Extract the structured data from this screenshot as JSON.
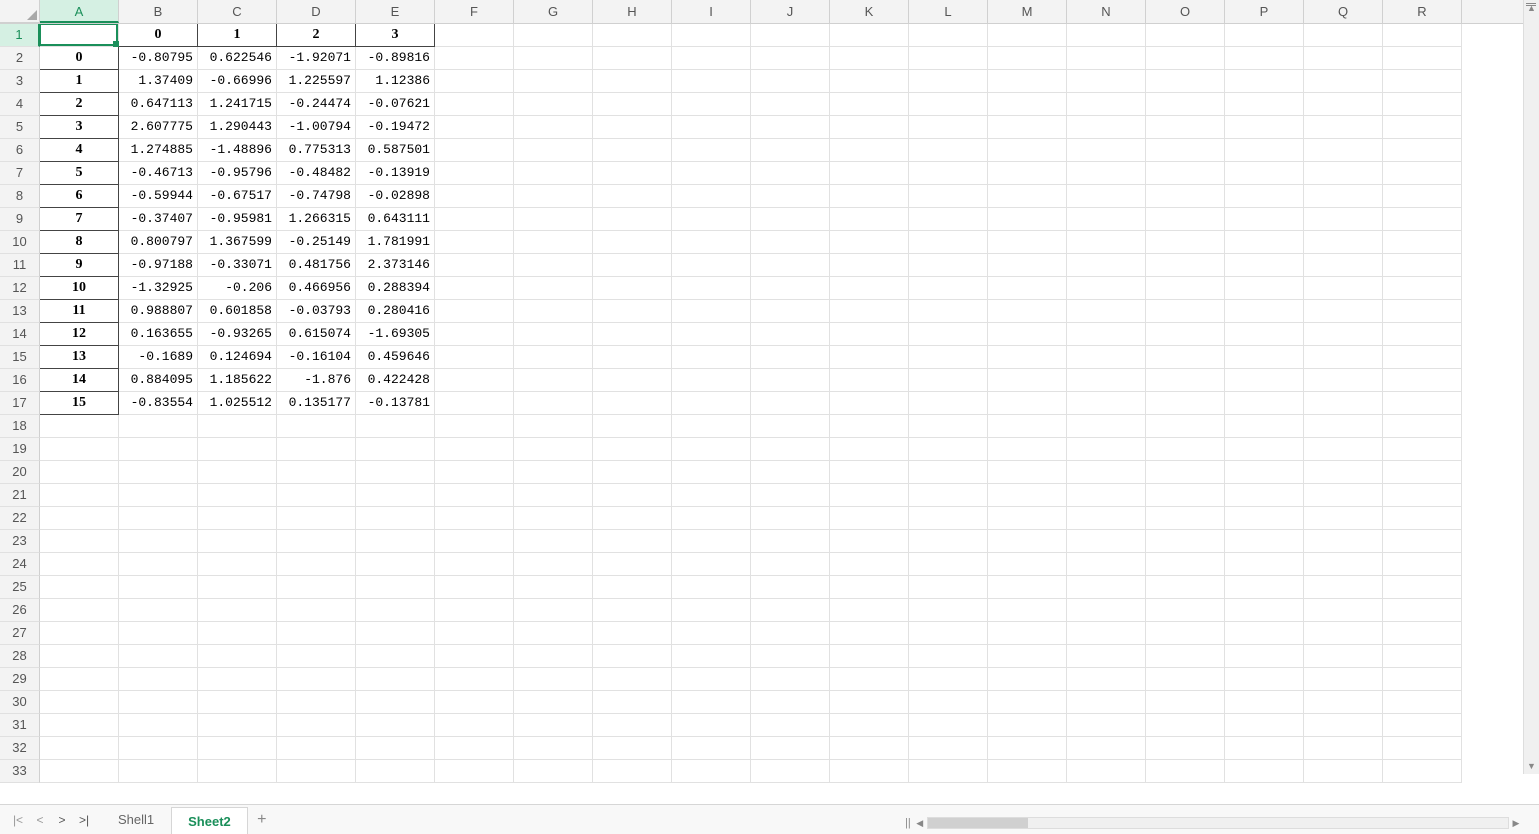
{
  "columns": [
    "A",
    "B",
    "C",
    "D",
    "E",
    "F",
    "G",
    "H",
    "I",
    "J",
    "K",
    "L",
    "M",
    "N",
    "O",
    "P",
    "Q",
    "R"
  ],
  "row_count": 33,
  "data_headers": [
    "",
    "0",
    "1",
    "2",
    "3"
  ],
  "data_rows": [
    {
      "idx": "0",
      "v": [
        "-0.80795",
        "0.622546",
        "-1.92071",
        "-0.89816"
      ]
    },
    {
      "idx": "1",
      "v": [
        "1.37409",
        "-0.66996",
        "1.225597",
        "1.12386"
      ]
    },
    {
      "idx": "2",
      "v": [
        "0.647113",
        "1.241715",
        "-0.24474",
        "-0.07621"
      ]
    },
    {
      "idx": "3",
      "v": [
        "2.607775",
        "1.290443",
        "-1.00794",
        "-0.19472"
      ]
    },
    {
      "idx": "4",
      "v": [
        "1.274885",
        "-1.48896",
        "0.775313",
        "0.587501"
      ]
    },
    {
      "idx": "5",
      "v": [
        "-0.46713",
        "-0.95796",
        "-0.48482",
        "-0.13919"
      ]
    },
    {
      "idx": "6",
      "v": [
        "-0.59944",
        "-0.67517",
        "-0.74798",
        "-0.02898"
      ]
    },
    {
      "idx": "7",
      "v": [
        "-0.37407",
        "-0.95981",
        "1.266315",
        "0.643111"
      ]
    },
    {
      "idx": "8",
      "v": [
        "0.800797",
        "1.367599",
        "-0.25149",
        "1.781991"
      ]
    },
    {
      "idx": "9",
      "v": [
        "-0.97188",
        "-0.33071",
        "0.481756",
        "2.373146"
      ]
    },
    {
      "idx": "10",
      "v": [
        "-1.32925",
        "-0.206",
        "0.466956",
        "0.288394"
      ]
    },
    {
      "idx": "11",
      "v": [
        "0.988807",
        "0.601858",
        "-0.03793",
        "0.280416"
      ]
    },
    {
      "idx": "12",
      "v": [
        "0.163655",
        "-0.93265",
        "0.615074",
        "-1.69305"
      ]
    },
    {
      "idx": "13",
      "v": [
        "-0.1689",
        "0.124694",
        "-0.16104",
        "0.459646"
      ]
    },
    {
      "idx": "14",
      "v": [
        "0.884095",
        "1.185622",
        "-1.876",
        "0.422428"
      ]
    },
    {
      "idx": "15",
      "v": [
        "-0.83554",
        "1.025512",
        "0.135177",
        "-0.13781"
      ]
    }
  ],
  "tabs": [
    {
      "label": "Shell1",
      "active": false
    },
    {
      "label": "Sheet2",
      "active": true
    }
  ],
  "selected_cell": {
    "col": 0,
    "row": 0
  },
  "nav": {
    "first": "|<",
    "prev": "<",
    "next": ">",
    "last": ">|",
    "add": "+"
  },
  "scroll": {
    "split": "||",
    "left": "◀",
    "right": "▶"
  }
}
